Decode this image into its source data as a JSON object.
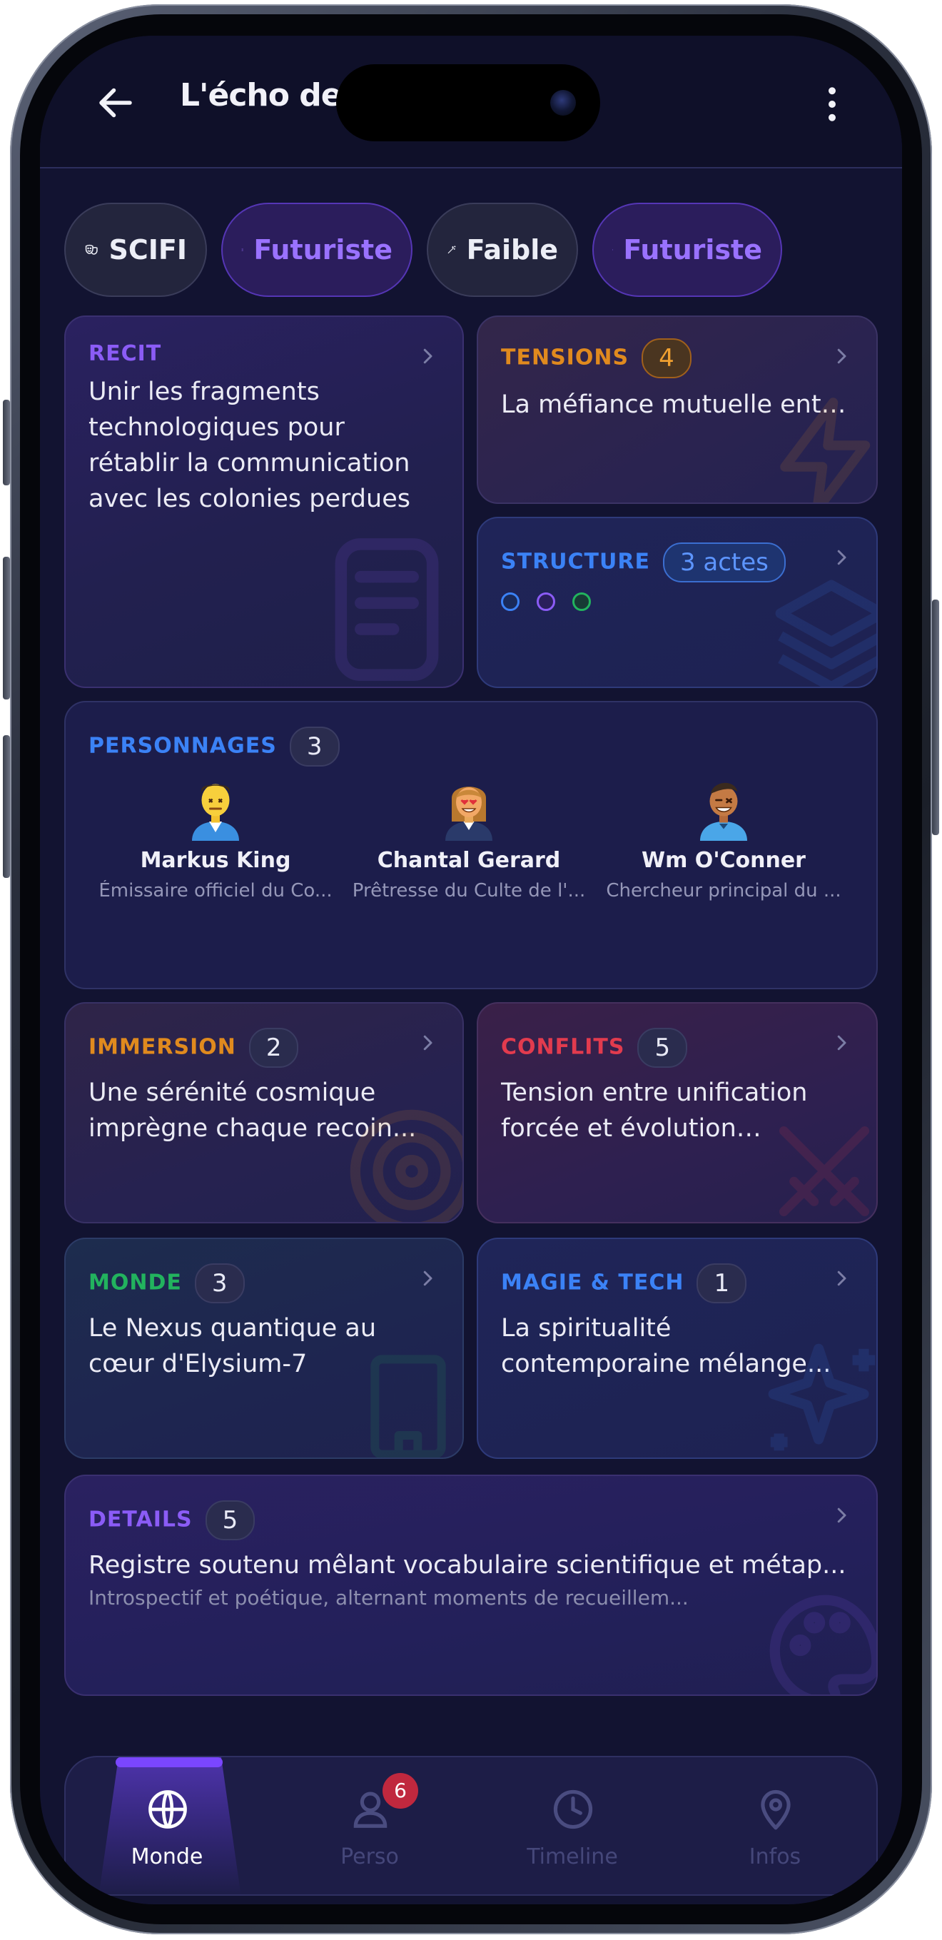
{
  "header": {
    "title": "L'écho des",
    "back_icon": "arrow-left-icon",
    "menu_icon": "more-vertical-icon"
  },
  "chips": [
    {
      "label": "SCIFI",
      "icon": "drama-masks-icon",
      "style": "grey"
    },
    {
      "label": "Futuriste",
      "icon": "hourglass-icon",
      "style": "purple"
    },
    {
      "label": "Faible",
      "icon": "magic-wand-icon",
      "style": "grey"
    },
    {
      "label": "Futuriste",
      "icon": "cpu-chip-icon",
      "style": "purple"
    }
  ],
  "recit": {
    "label": "RECIT",
    "text": "Unir les fragments technologiques pour rétablir la communication avec les colonies perdues"
  },
  "tensions": {
    "label": "TENSIONS",
    "count": "4",
    "text": "La méfiance mutuelle entre..."
  },
  "structure": {
    "label": "STRUCTURE",
    "badge": "3 actes"
  },
  "personnages": {
    "label": "PERSONNAGES",
    "count": "3",
    "characters": [
      {
        "name": "Markus King",
        "role": "Émissaire officiel du Co..."
      },
      {
        "name": "Chantal Gerard",
        "role": "Prêtresse du Culte de l'..."
      },
      {
        "name": "Wm O'Conner",
        "role": "Chercheur principal du ..."
      }
    ]
  },
  "immersion": {
    "label": "IMMERSION",
    "count": "2",
    "text": "Une sérénité cosmique imprègne chaque recoin..."
  },
  "conflits": {
    "label": "CONFLITS",
    "count": "5",
    "text": "Tension entre unification forcée et évolution naturell..."
  },
  "monde": {
    "label": "MONDE",
    "count": "3",
    "text": "Le Nexus quantique au cœur d'Elysium-7"
  },
  "magie": {
    "label": "MAGIE & TECH",
    "count": "1",
    "text": "La spiritualité contemporaine mélange..."
  },
  "details": {
    "label": "DETAILS",
    "count": "5",
    "text": "Registre soutenu mêlant vocabulaire scientifique et métap...",
    "subtext": "Introspectif et poétique, alternant moments de recueillem..."
  },
  "nav": [
    {
      "label": "Monde",
      "icon": "globe-icon",
      "active": true
    },
    {
      "label": "Perso",
      "icon": "user-icon",
      "badge": "6"
    },
    {
      "label": "Timeline",
      "icon": "clock-icon"
    },
    {
      "label": "Infos",
      "icon": "map-pin-icon"
    }
  ],
  "colors": {
    "recit": "#8b5cf6",
    "tensions": "#e08a1e",
    "structure": "#3b82f6",
    "personnages": "#3b82f6",
    "immersion": "#e08a1e",
    "conflits": "#e23b4e",
    "monde": "#22b35e",
    "magie": "#3b82f6",
    "details": "#8b5cf6",
    "accent": "#7a46ff"
  }
}
